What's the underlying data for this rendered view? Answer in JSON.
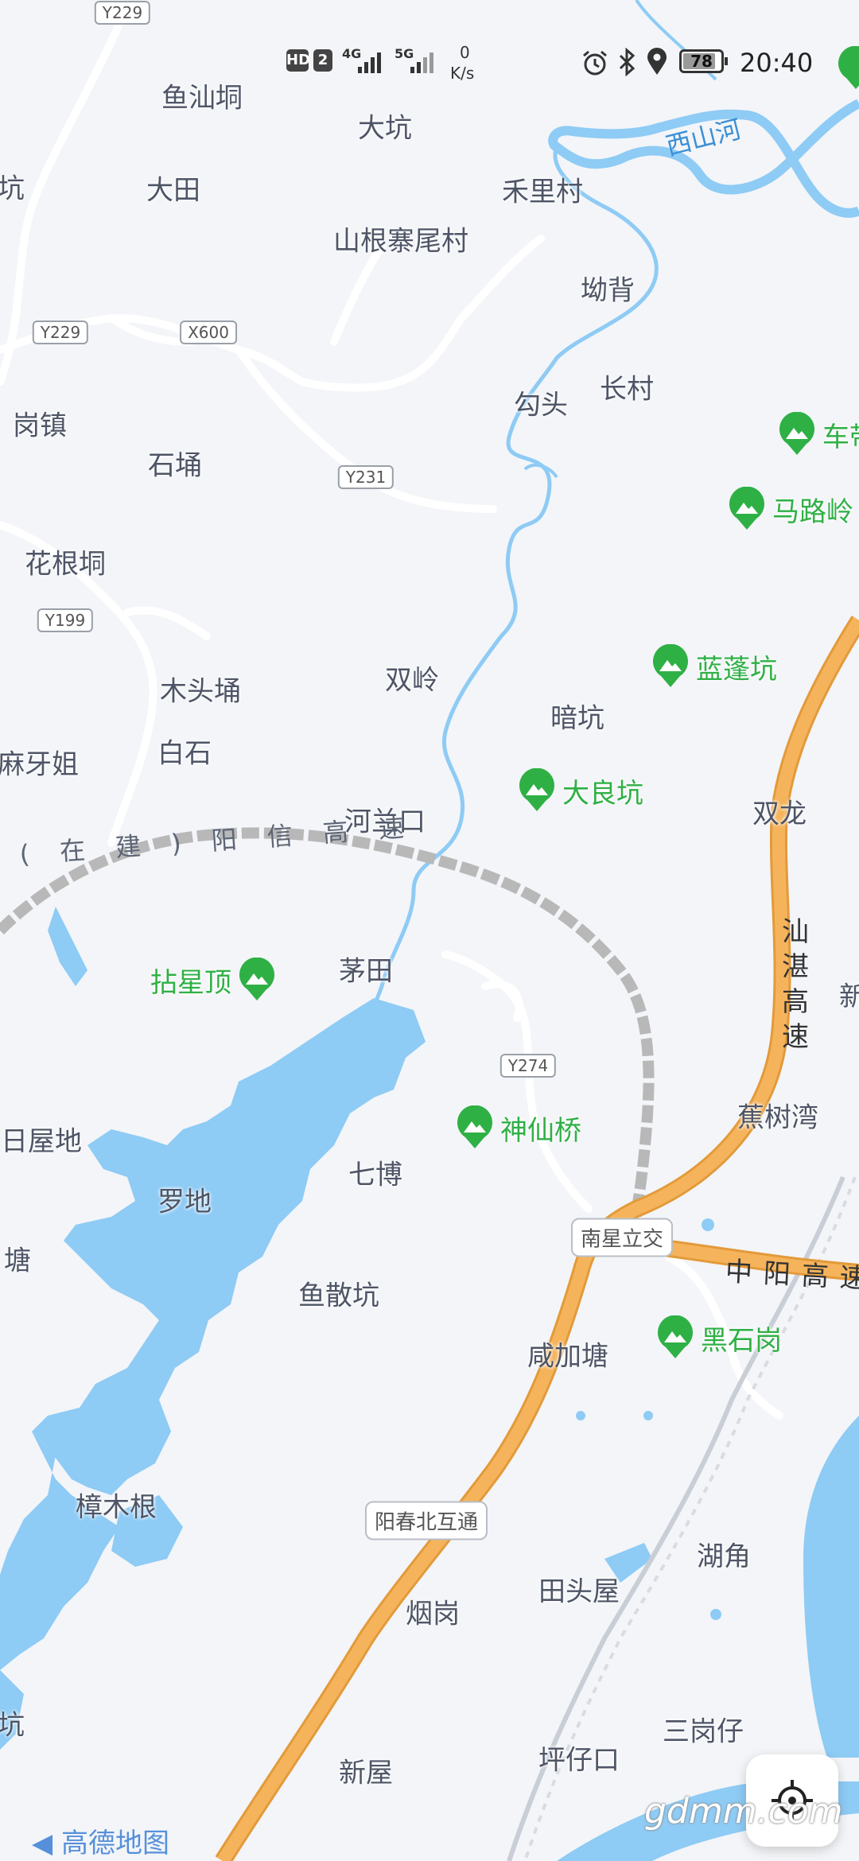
{
  "status_bar": {
    "hd": "HD",
    "hd_num": "2",
    "net1": "4G",
    "net2": "5G",
    "speed_value": "0",
    "speed_unit": "K/s",
    "battery": "78",
    "time": "20:40"
  },
  "places": [
    {
      "id": "yushandong",
      "name": "鱼汕垌"
    },
    {
      "id": "dakeng",
      "name": "大坑"
    },
    {
      "id": "keng-left",
      "name": "坑"
    },
    {
      "id": "datian",
      "name": "大田"
    },
    {
      "id": "helicun",
      "name": "禾里村"
    },
    {
      "id": "shangenzhaiweicun",
      "name": "山根寨尾村"
    },
    {
      "id": "aobei",
      "name": "坳背"
    },
    {
      "id": "gangzhen",
      "name": "岗镇"
    },
    {
      "id": "goutou",
      "name": "勾头"
    },
    {
      "id": "changcun",
      "name": "长村"
    },
    {
      "id": "shiyong",
      "name": "石埇"
    },
    {
      "id": "huagendong",
      "name": "花根垌"
    },
    {
      "id": "shuangling",
      "name": "双岭"
    },
    {
      "id": "ankeng",
      "name": "暗坑"
    },
    {
      "id": "mutouyong",
      "name": "木头埇"
    },
    {
      "id": "baishi",
      "name": "白石"
    },
    {
      "id": "mayajie",
      "name": "麻牙姐"
    },
    {
      "id": "shuanglong",
      "name": "双龙"
    },
    {
      "id": "helankou",
      "name": "河兰口"
    },
    {
      "id": "maotian",
      "name": "茅田"
    },
    {
      "id": "xin-right",
      "name": "新"
    },
    {
      "id": "jiaoshuwan",
      "name": "蕉树湾"
    },
    {
      "id": "riwudi",
      "name": "日屋地"
    },
    {
      "id": "qibo",
      "name": "七博"
    },
    {
      "id": "luodi",
      "name": "罗地"
    },
    {
      "id": "tang-left",
      "name": "塘"
    },
    {
      "id": "yusankeng",
      "name": "鱼散坑"
    },
    {
      "id": "xianjiatang",
      "name": "咸加塘"
    },
    {
      "id": "zhangmugen",
      "name": "樟木根"
    },
    {
      "id": "hujiao",
      "name": "湖角"
    },
    {
      "id": "tiantouwu",
      "name": "田头屋"
    },
    {
      "id": "yangang",
      "name": "烟岗"
    },
    {
      "id": "kang-left",
      "name": "坑"
    },
    {
      "id": "sangangzai",
      "name": "三岗仔"
    },
    {
      "id": "xinwu",
      "name": "新屋"
    },
    {
      "id": "pingzaikou",
      "name": "坪仔口"
    }
  ],
  "pois": [
    {
      "id": "chedai",
      "name": "车带"
    },
    {
      "id": "malulin",
      "name": "马路岭"
    },
    {
      "id": "lanpengkeng",
      "name": "蓝蓬坑"
    },
    {
      "id": "daliangkeng",
      "name": "大良坑"
    },
    {
      "id": "zhanxingding",
      "name": "拈星顶"
    },
    {
      "id": "shenxianqiao",
      "name": "神仙桥"
    },
    {
      "id": "heishigang",
      "name": "黑石岗"
    }
  ],
  "road_tags": [
    {
      "id": "y229-top",
      "label": "Y229"
    },
    {
      "id": "y229-mid",
      "label": "Y229"
    },
    {
      "id": "x600",
      "label": "X600"
    },
    {
      "id": "y231",
      "label": "Y231"
    },
    {
      "id": "y199",
      "label": "Y199"
    },
    {
      "id": "y274",
      "label": "Y274"
    }
  ],
  "interchanges": [
    {
      "id": "nanxing",
      "label": "南星立交"
    },
    {
      "id": "yangchunbei",
      "label": "阳春北互通"
    }
  ],
  "highways": {
    "shanzhan": "汕湛高速",
    "zhongyang": "中阳高速",
    "yangxin": "( 在 建 ) 阳 信 高 速"
  },
  "rivers": {
    "xishanhe": "西山河"
  },
  "brand": "高德地图",
  "watermark": "gdmm.com",
  "colors": {
    "background": "#f3f5f8",
    "water": "#8ecbf5",
    "highway": "#f5b45c",
    "highway_edge": "#e39a3a",
    "poi_green": "#2fb045",
    "road_white": "#ffffff",
    "construction": "#b8b8b8"
  },
  "icons": {
    "location_button": "locate-icon",
    "poi_marker": "mountain-pin-icon"
  }
}
